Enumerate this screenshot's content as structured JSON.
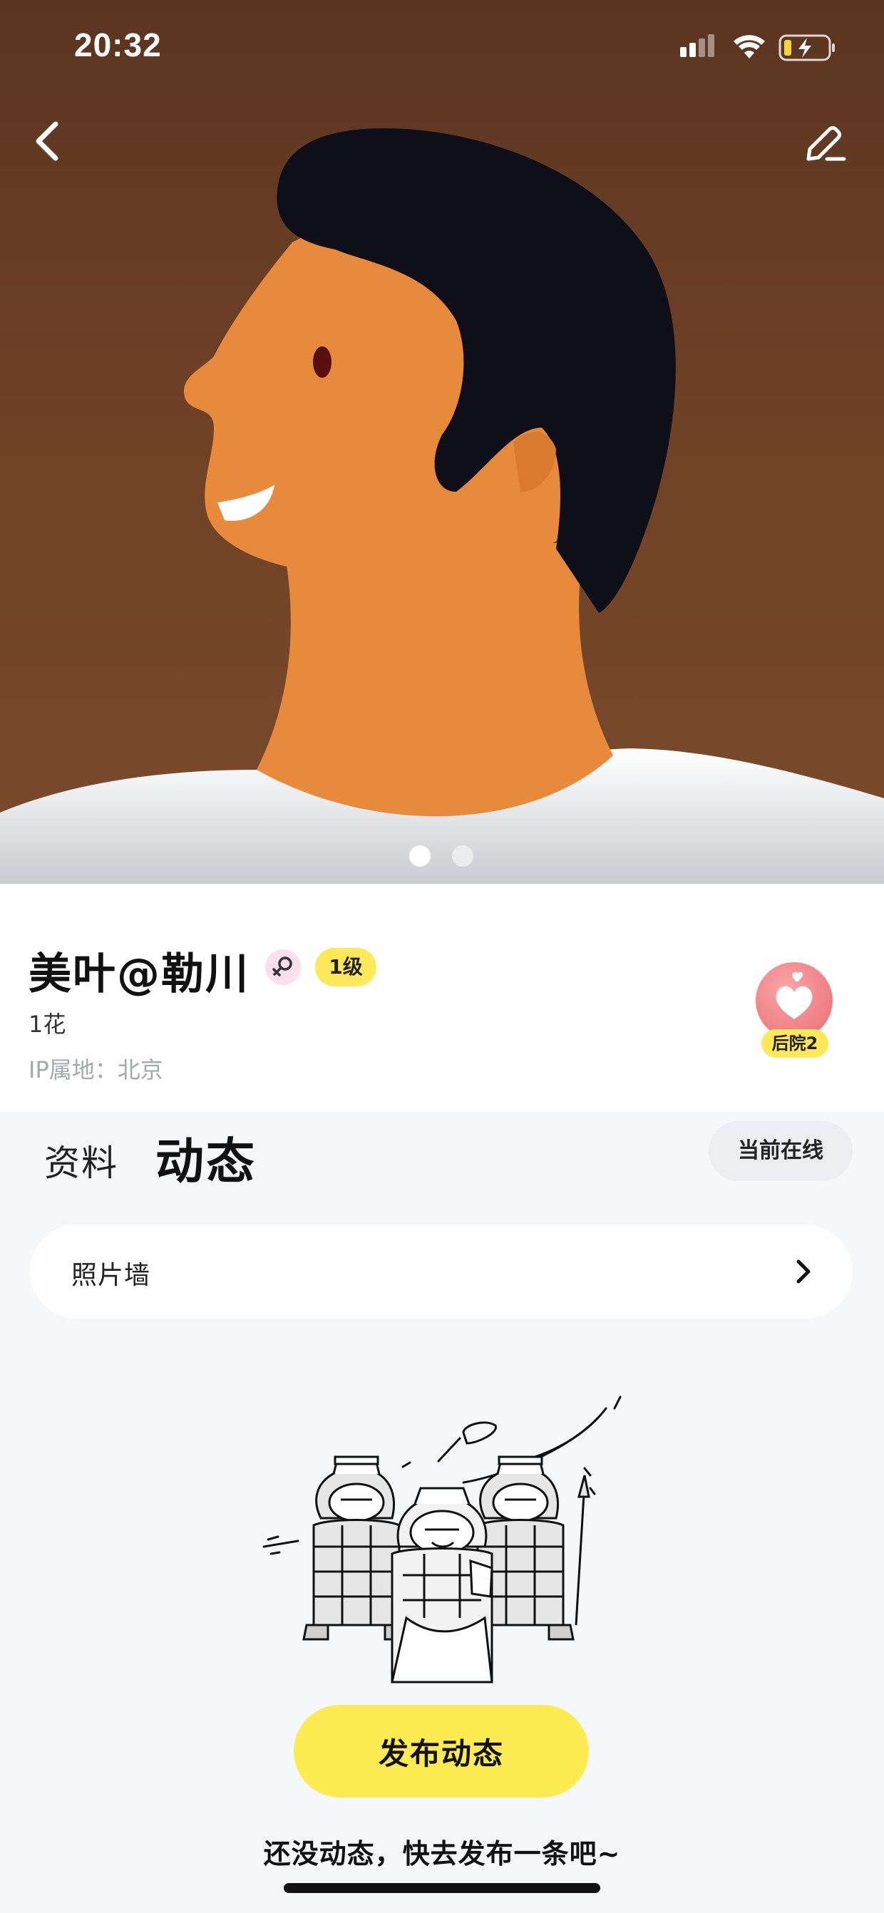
{
  "status_bar": {
    "time": "20:32",
    "icons": [
      "signal-icon",
      "wifi-icon",
      "battery-charging-icon"
    ]
  },
  "nav": {
    "back_icon": "chevron-left-icon",
    "edit_icon": "pen-icon"
  },
  "hero": {
    "slide_count": 2,
    "active_slide": 1
  },
  "profile": {
    "name": "美叶@勒川",
    "gender_icon": "female-icon",
    "level": "1级",
    "flowers": "1花",
    "ip_location": "IP属地：北京",
    "harem_icon": "heart-icon",
    "harem_label": "后院2"
  },
  "tabs": {
    "info": "资料",
    "moments": "动态",
    "online_status": "当前在线"
  },
  "photo_wall": {
    "label": "照片墙",
    "icon": "chevron-right-icon"
  },
  "empty_state": {
    "publish_button": "发布动态",
    "message": "还没动态，快去发布一条吧~"
  },
  "colors": {
    "accent_yellow": "#fdeb52",
    "hero_brown": "#6b3f24",
    "skin_orange": "#e88a3c",
    "hair_black": "#0f0f1a",
    "harem_pink": "#ef7d83",
    "page_bg": "#f6f7f9"
  }
}
